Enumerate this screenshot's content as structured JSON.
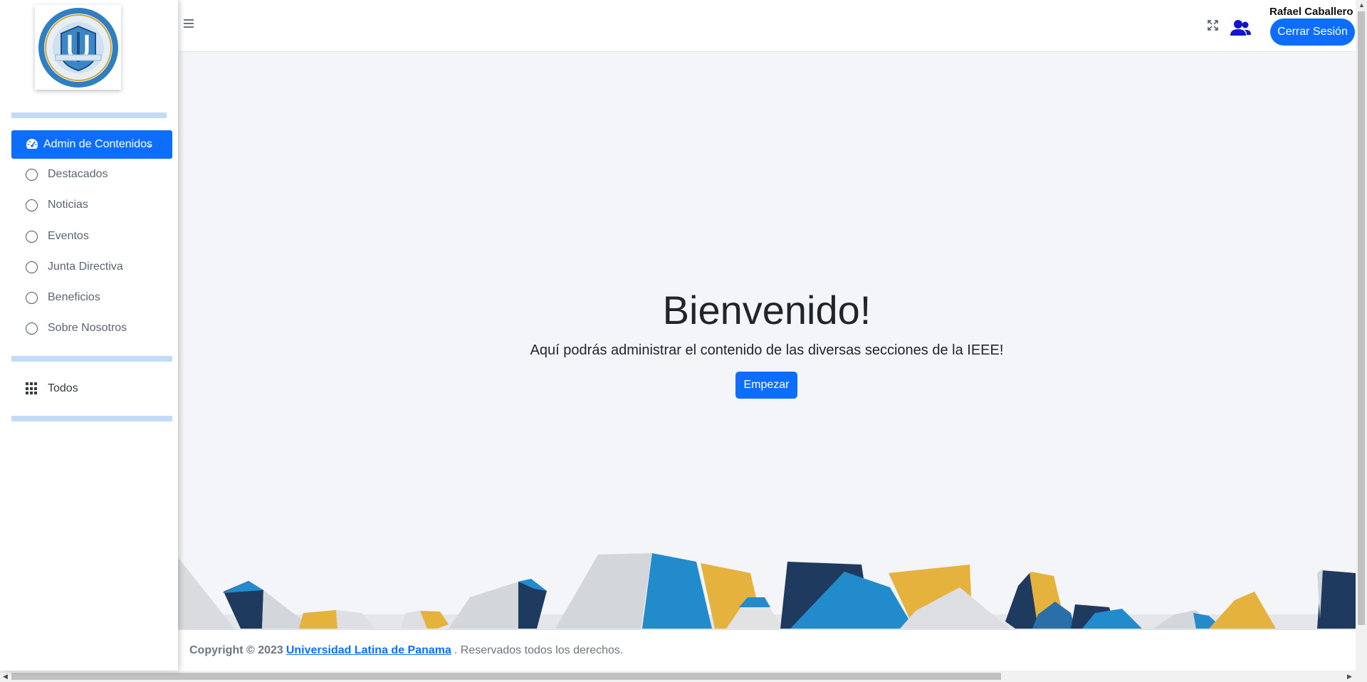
{
  "sidebar": {
    "logo_alt": "Universidad Latina de Panamá",
    "active_item": {
      "label": "Admin de Contenidos",
      "icon": "dashboard-icon"
    },
    "items": [
      {
        "label": "Destacados",
        "icon": "circle-icon"
      },
      {
        "label": "Noticias",
        "icon": "circle-icon"
      },
      {
        "label": "Eventos",
        "icon": "circle-icon"
      },
      {
        "label": "Junta Directiva",
        "icon": "circle-icon"
      },
      {
        "label": "Beneficios",
        "icon": "circle-icon"
      },
      {
        "label": "Sobre Nosotros",
        "icon": "circle-icon"
      }
    ],
    "todos": {
      "label": "Todos",
      "icon": "grid-icon"
    }
  },
  "header": {
    "user_name": "Rafael Caballero",
    "logout_label": "Cerrar Sesión",
    "icons": [
      "menu-icon",
      "expand-icon",
      "users-icon"
    ]
  },
  "main": {
    "title": "Bienvenido!",
    "subtitle": "Aquí podrás administrar el contenido de las diversas secciones de la IEEE!",
    "start_label": "Empezar"
  },
  "footer": {
    "copyright": "Copyright © 2023",
    "link_text": "Universidad Latina de Panama",
    "rights": ". Reservados todos los derechos."
  },
  "colors": {
    "primary": "#0d6efd",
    "background": "#f4f5f9",
    "separator": "#c2dbf7",
    "navy": "#1f3a5f",
    "blue": "#228bcc",
    "gold": "#e5b23d",
    "gray": "#d3d6da"
  }
}
